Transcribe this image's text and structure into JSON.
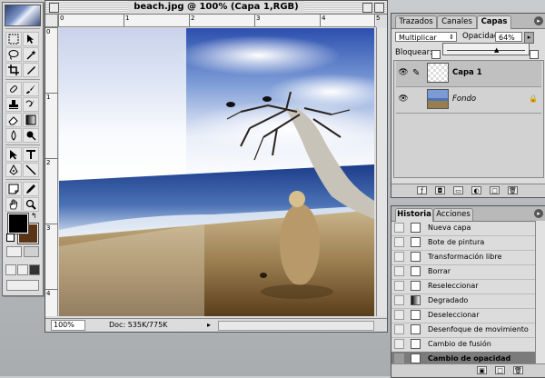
{
  "document": {
    "title": "beach.jpg @ 100% (Capa 1,RGB)",
    "zoom": "100%",
    "doc_size": "Doc: 535K/775K",
    "ruler_top_ticks": [
      "0",
      "1",
      "2",
      "3",
      "4",
      "5"
    ],
    "ruler_left_ticks": [
      "0",
      "1",
      "2",
      "3",
      "4"
    ]
  },
  "layers_palette": {
    "tabs": [
      "Trazados",
      "Canales",
      "Capas"
    ],
    "active_tab": "Capas",
    "blend_mode": "Multiplicar",
    "opacity_label": "Opacidad:",
    "opacity_value": "64%",
    "opacity_fraction": 0.64,
    "lock_label": "Bloquear:",
    "layers": [
      {
        "name": "Capa 1",
        "selected": true
      },
      {
        "name": "Fondo",
        "selected": false,
        "locked": true
      }
    ]
  },
  "history_palette": {
    "tabs": [
      "Historia",
      "Acciones"
    ],
    "active_tab": "Historia",
    "items": [
      "Nueva capa",
      "Bote de pintura",
      "Transformación libre",
      "Borrar",
      "Reseleccionar",
      "Degradado",
      "Deseleccionar",
      "Desenfoque de movimiento",
      "Cambio de fusión",
      "Cambio de opacidad"
    ],
    "selected_index": 9
  },
  "toolbox": {
    "tools": [
      "marquee",
      "move",
      "lasso",
      "magic-wand",
      "crop",
      "slice",
      "healing",
      "brush",
      "stamp",
      "history-brush",
      "eraser",
      "gradient",
      "blur",
      "dodge",
      "path-select",
      "type",
      "pen",
      "line",
      "notes",
      "eyedropper",
      "hand",
      "zoom"
    ],
    "foreground_color": "#000000",
    "background_color": "#5b3416"
  }
}
